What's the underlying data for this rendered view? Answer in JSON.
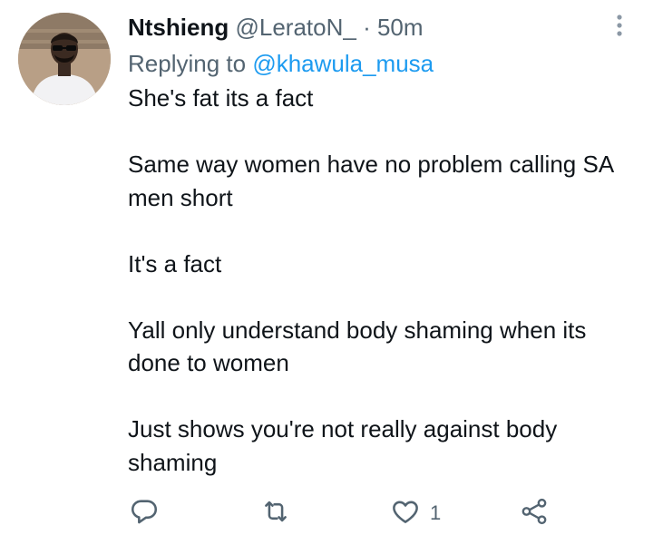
{
  "tweet": {
    "display_name": "Ntshieng",
    "handle": "@LeratoN_",
    "separator": "·",
    "time": "50m",
    "replying_prefix": "Replying to",
    "replying_to": "@khawula_musa",
    "paragraphs": [
      [
        "She's fat its a fact"
      ],
      [
        "Same way women have no problem calling SA",
        "men short"
      ],
      [
        "It's a fact"
      ],
      [
        "Yall only understand body shaming when its",
        "done to women"
      ],
      [
        "Just shows you're not really against body",
        "shaming"
      ]
    ],
    "like_count": "1"
  },
  "icons": {
    "more": "more-vertical-icon",
    "reply": "reply-bubble-icon",
    "retweet": "retweet-icon",
    "like": "heart-icon",
    "share": "share-icon"
  },
  "colors": {
    "text": "#0f1419",
    "secondary": "#536471",
    "mention": "#1d9bf0"
  }
}
